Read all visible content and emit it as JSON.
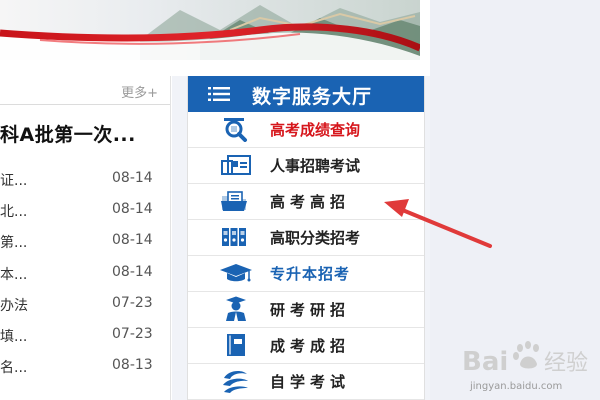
{
  "news": {
    "more_label": "更多+",
    "headline": "科A批第一次...",
    "items": [
      {
        "title": "证...",
        "date": "08-14"
      },
      {
        "title": "北...",
        "date": "08-14"
      },
      {
        "title": "第...",
        "date": "08-14"
      },
      {
        "title": "本...",
        "date": "08-14"
      },
      {
        "title": "办法",
        "date": "07-23"
      },
      {
        "title": "填...",
        "date": "07-23"
      },
      {
        "title": "名...",
        "date": "08-13"
      }
    ]
  },
  "hall": {
    "title": "数字服务大厅",
    "items": [
      {
        "label": "高考成绩查询",
        "icon": "magnifier-icon"
      },
      {
        "label": "人事招聘考试",
        "icon": "id-card-icon"
      },
      {
        "label": "高考高招",
        "icon": "folder-icon"
      },
      {
        "label": "高职分类招考",
        "icon": "binders-icon"
      },
      {
        "label": "专升本招考",
        "icon": "graduation-cap-icon"
      },
      {
        "label": "研考研招",
        "icon": "graduate-icon"
      },
      {
        "label": "成考成招",
        "icon": "book-icon"
      },
      {
        "label": "自学考试",
        "icon": "self-study-icon"
      }
    ]
  },
  "watermark": {
    "brand": "Bai",
    "brand_suffix": "经验",
    "url": "jingyan.baidu.com"
  },
  "colors": {
    "hall_blue": "#1a63b3",
    "highlight_red": "#d6161c",
    "arrow_red": "#e03a3a"
  }
}
